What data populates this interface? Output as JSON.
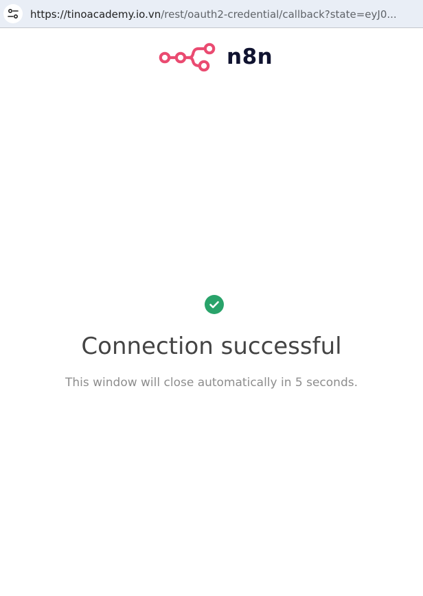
{
  "browser": {
    "url_host": "https://tinoacademy.io.vn",
    "url_path": "/rest/oauth2-credential/callback?state=eyJ0...",
    "site_info_icon": "tune-icon"
  },
  "logo": {
    "icon": "n8n-logo-icon",
    "text": "n8n",
    "mark_color": "#ea4b71",
    "text_color": "#101330"
  },
  "status": {
    "icon": "check-circle-icon",
    "icon_color": "#29a36a",
    "title": "Connection successful",
    "message": "This window will close automatically in 5 seconds."
  }
}
